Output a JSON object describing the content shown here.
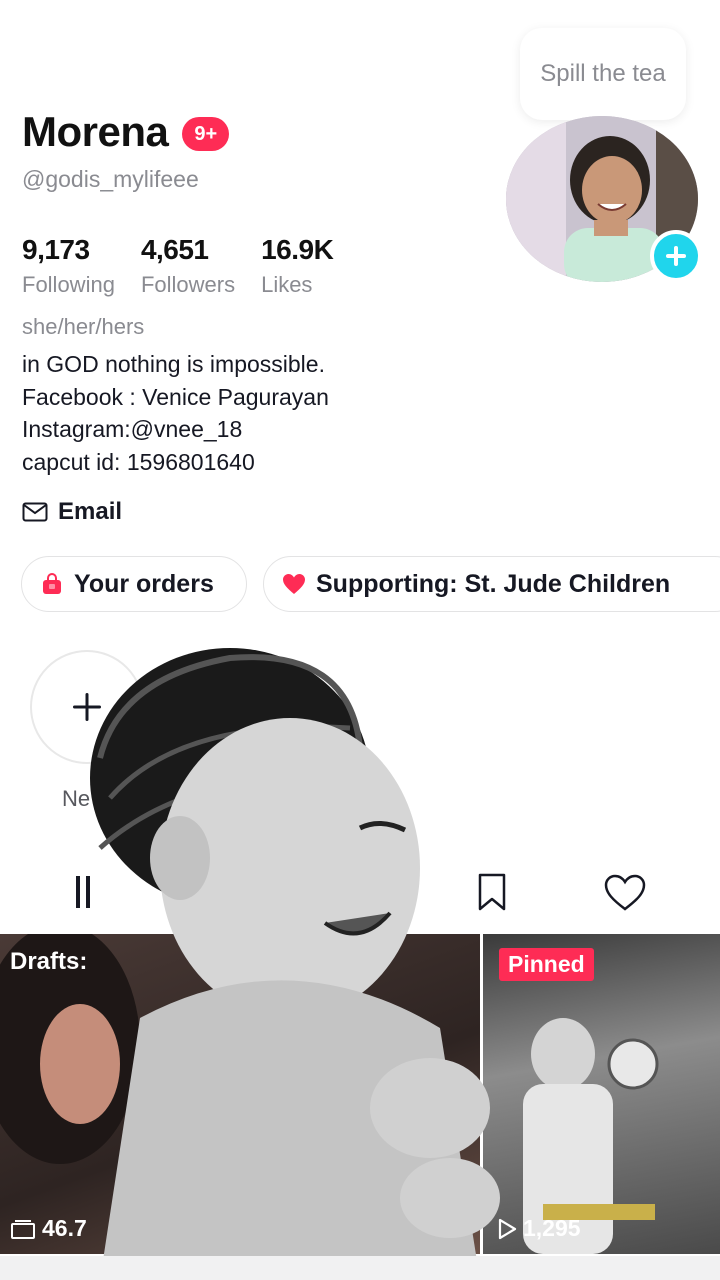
{
  "profile": {
    "display_name": "Morena",
    "notification_badge": "9+",
    "username": "@godis_mylifeee",
    "pronouns": "she/her/hers",
    "bio_lines": [
      "in GOD nothing is impossible.",
      "Facebook : Venice Pagurayan",
      "Instagram:@vnee_18",
      "capcut id: 1596801640"
    ],
    "avatar_bubble": "Spill the tea"
  },
  "stats": [
    {
      "value": "9,173",
      "label": "Following"
    },
    {
      "value": "4,651",
      "label": "Followers"
    },
    {
      "value": "16.9K",
      "label": "Likes"
    }
  ],
  "email_label": "Email",
  "chips": {
    "orders": "Your orders",
    "supporting": "Supporting: St. Jude Children"
  },
  "story": {
    "new_label": "Ne"
  },
  "grid": {
    "drafts_label": "Drafts:",
    "drafts_count": "46.7",
    "pinned_label": "Pinned",
    "pinned_views": "1,295"
  },
  "colors": {
    "accent_red": "#fe2c55",
    "accent_cyan": "#20d5ec",
    "muted_text": "#8a8b91"
  },
  "icons": [
    "mail-icon",
    "shopping-bag-icon",
    "heart-icon",
    "plus-icon",
    "grid-icon",
    "bookmark-icon",
    "liked-heart-icon",
    "play-icon",
    "drafts-icon"
  ]
}
